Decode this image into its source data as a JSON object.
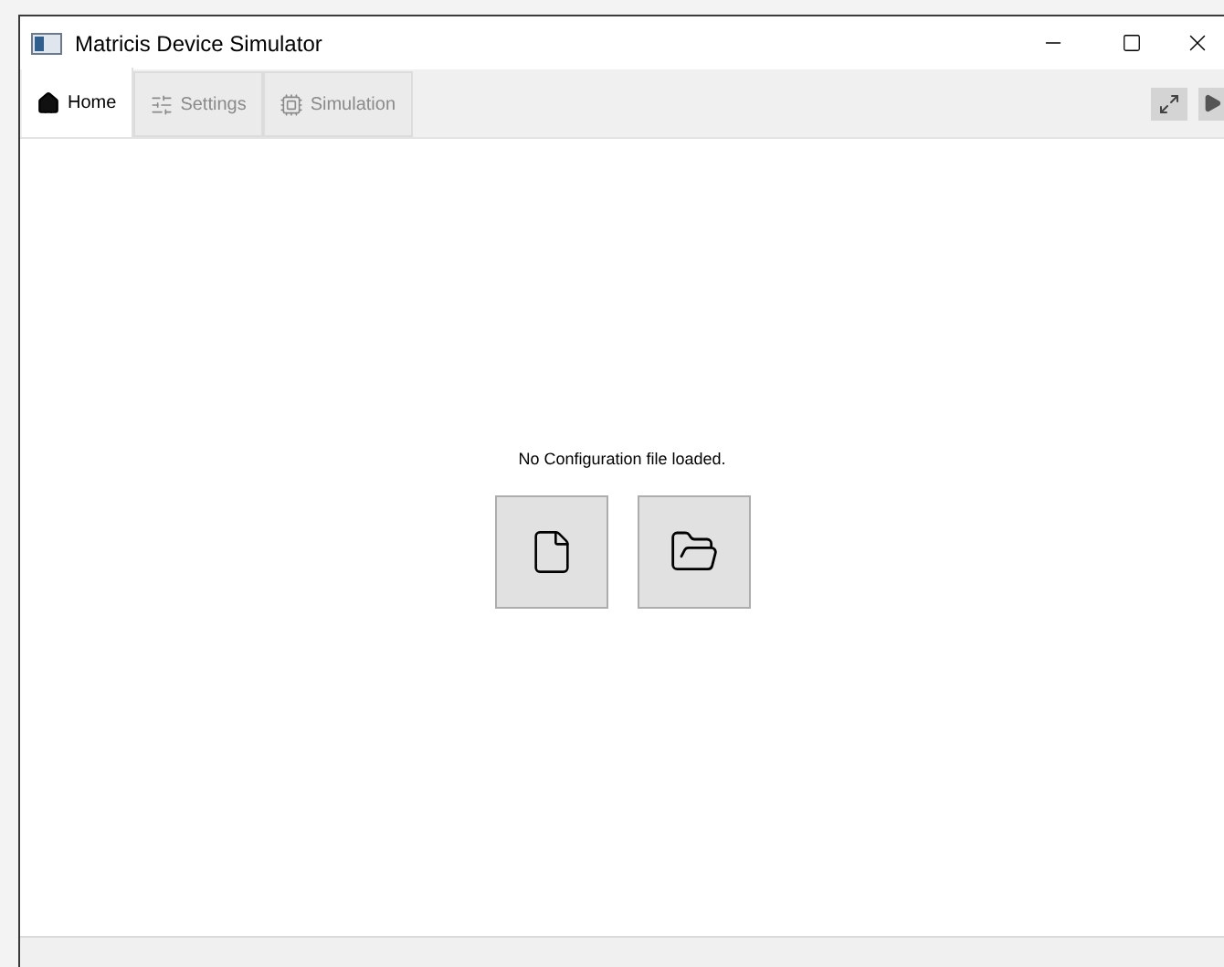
{
  "window": {
    "title": "Matricis Device Simulator"
  },
  "tabs": [
    {
      "label": "Home",
      "kind": "home",
      "selected": true
    },
    {
      "label": "Settings",
      "kind": "sliders",
      "selected": false
    },
    {
      "label": "Simulation",
      "kind": "chip",
      "selected": false
    }
  ],
  "content": {
    "message": "No Configuration file loaded."
  }
}
